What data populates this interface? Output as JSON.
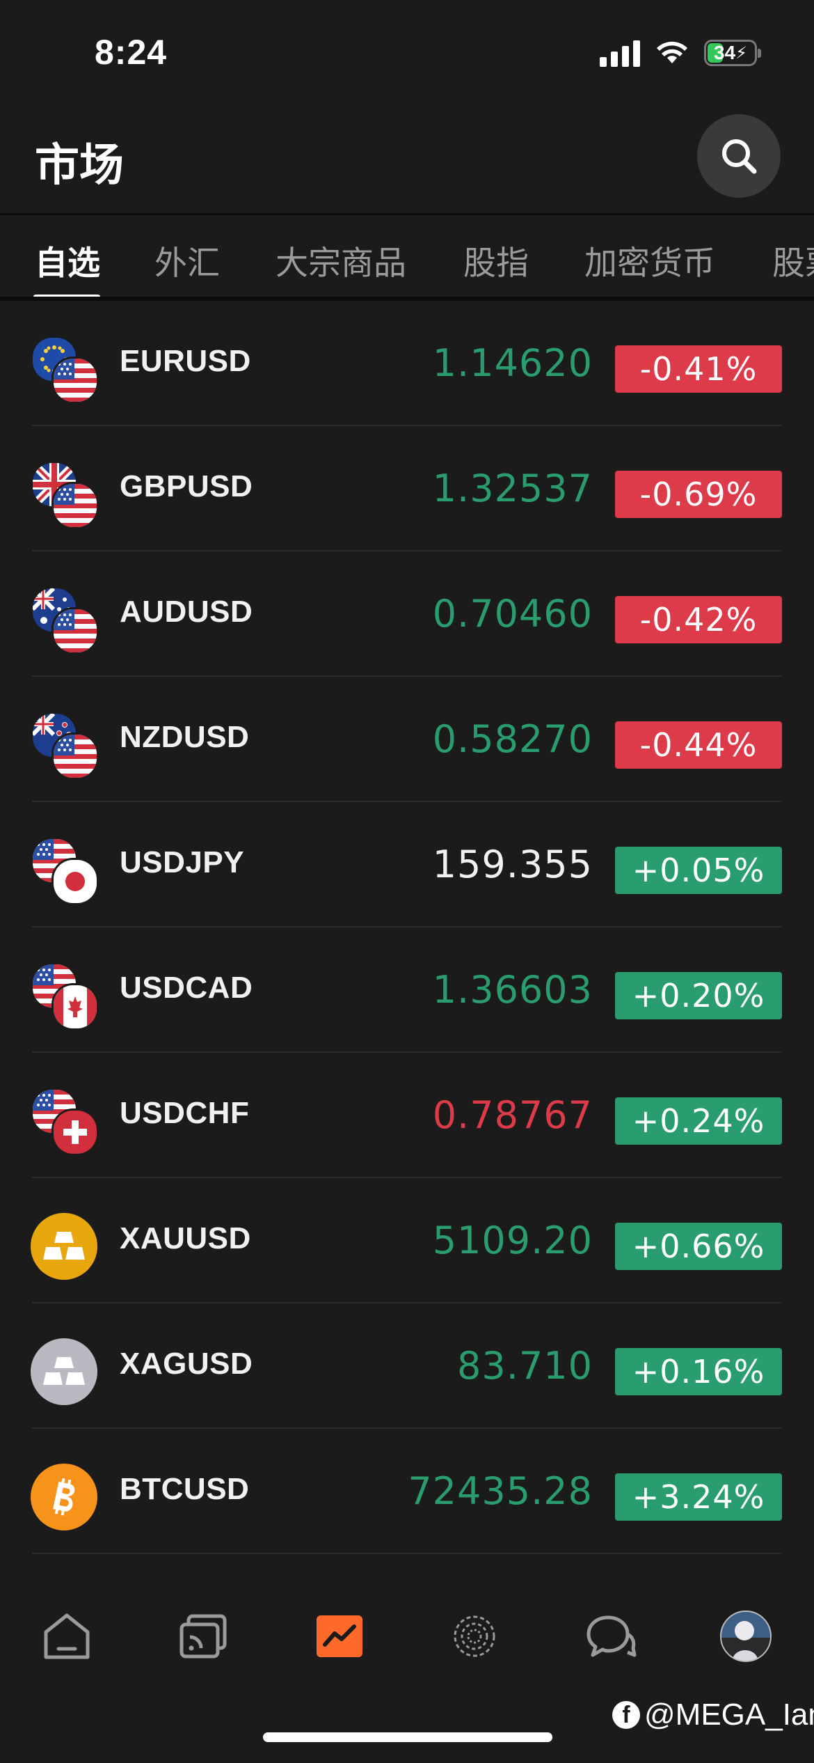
{
  "status": {
    "time": "8:24",
    "battery": "34"
  },
  "header": {
    "title": "市场"
  },
  "tabs": [
    "自选",
    "外汇",
    "大宗商品",
    "股指",
    "加密货币",
    "股票"
  ],
  "markets": [
    {
      "symbol": "EURUSD",
      "price": "1.14620",
      "change": "-0.41%"
    },
    {
      "symbol": "GBPUSD",
      "price": "1.32537",
      "change": "-0.69%"
    },
    {
      "symbol": "AUDUSD",
      "price": "0.70460",
      "change": "-0.42%"
    },
    {
      "symbol": "NZDUSD",
      "price": "0.58270",
      "change": "-0.44%"
    },
    {
      "symbol": "USDJPY",
      "price": "159.355",
      "change": "+0.05%"
    },
    {
      "symbol": "USDCAD",
      "price": "1.36603",
      "change": "+0.20%"
    },
    {
      "symbol": "USDCHF",
      "price": "0.78767",
      "change": "+0.24%"
    },
    {
      "symbol": "XAUUSD",
      "price": "5109.20",
      "change": "+0.66%"
    },
    {
      "symbol": "XAGUSD",
      "price": "83.710",
      "change": "+0.16%"
    },
    {
      "symbol": "BTCUSD",
      "price": "72435.28",
      "change": "+3.24%"
    }
  ],
  "colors": {
    "background": "#1b1b1b",
    "up_green": "#2a9d6f",
    "down_red": "#dd3a4a",
    "neutral": "#f1f1f1",
    "accent_orange": "#ff6a2b"
  },
  "bottom_nav": [
    {
      "icon": "home-icon"
    },
    {
      "icon": "feed-icon"
    },
    {
      "icon": "market-chart-icon"
    },
    {
      "icon": "discover-icon"
    },
    {
      "icon": "chat-icon"
    },
    {
      "icon": "avatar"
    }
  ],
  "watermark": {
    "text": "@MEGA_Ian"
  }
}
